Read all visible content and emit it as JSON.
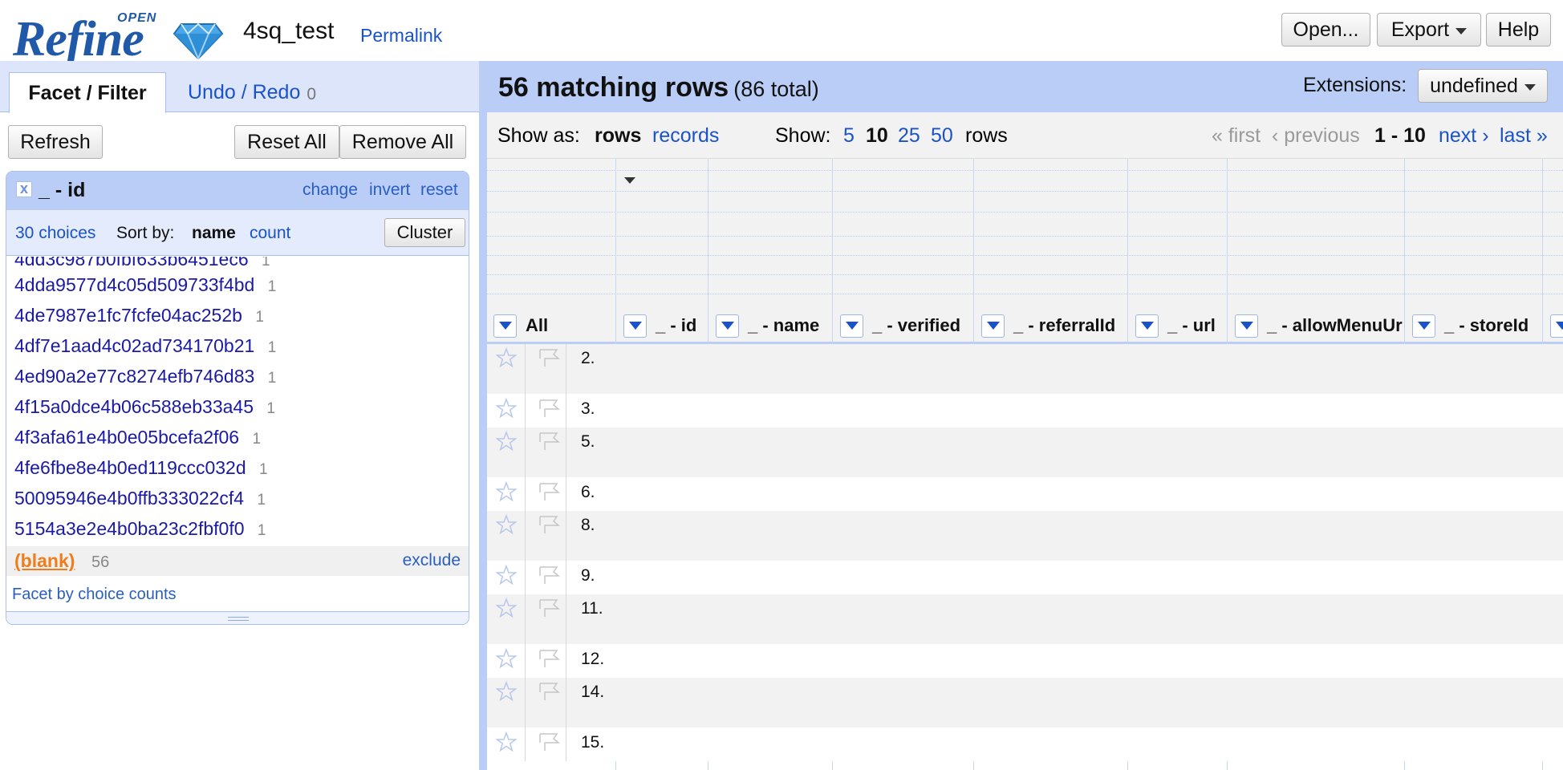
{
  "header": {
    "logo_text": "Refine",
    "logo_open": "OPEN",
    "project_name": "4sq_test",
    "permalink": "Permalink",
    "buttons": {
      "open": "Open...",
      "export": "Export",
      "help": "Help"
    }
  },
  "left_panel": {
    "tabs": {
      "facet_filter": "Facet / Filter",
      "undo_redo": "Undo / Redo",
      "undo_count": "0"
    },
    "buttons": {
      "refresh": "Refresh",
      "reset_all": "Reset All",
      "remove_all": "Remove All"
    },
    "facet": {
      "close": "x",
      "title": "_ - id",
      "links": {
        "change": "change",
        "invert": "invert",
        "reset": "reset"
      },
      "choices_count": "30 choices",
      "sort_by": "Sort by:",
      "sort_name": "name",
      "sort_count": "count",
      "cluster": "Cluster",
      "partial_choice": "4dd3c987b0fbf633b6451ec6",
      "choices": [
        {
          "value": "4dda9577d4c05d509733f4bd",
          "count": "1"
        },
        {
          "value": "4de7987e1fc7fcfe04ac252b",
          "count": "1"
        },
        {
          "value": "4df7e1aad4c02ad734170b21",
          "count": "1"
        },
        {
          "value": "4ed90a2e77c8274efb746d83",
          "count": "1"
        },
        {
          "value": "4f15a0dce4b06c588eb33a45",
          "count": "1"
        },
        {
          "value": "4f3afa61e4b0e05bcefa2f06",
          "count": "1"
        },
        {
          "value": "4fe6fbe8e4b0ed119ccc032d",
          "count": "1"
        },
        {
          "value": "50095946e4b0ffb333022cf4",
          "count": "1"
        },
        {
          "value": "5154a3e2e4b0ba23c2fbf0f0",
          "count": "1"
        }
      ],
      "blank": {
        "label": "(blank)",
        "count": "56",
        "exclude": "exclude"
      },
      "facet_by_counts": "Facet by choice counts"
    }
  },
  "right_panel": {
    "summary": {
      "matching": "56 matching rows",
      "total": "(86 total)"
    },
    "extensions": {
      "label": "Extensions:",
      "value": "undefined"
    },
    "view": {
      "show_as": "Show as:",
      "rows": "rows",
      "records": "records",
      "show": "Show:",
      "page_sizes": [
        "5",
        "10",
        "25",
        "50"
      ],
      "selected_page_size": "10",
      "rows_suffix": "rows",
      "first": "« first",
      "previous": "‹ previous",
      "range": "1 - 10",
      "next": "next ›",
      "last": "last »"
    },
    "columns": [
      "All",
      "_ - id",
      "_ - name",
      "_ - verified",
      "_ - referralId",
      "_ - url",
      "_ - allowMenuUr",
      "_ - storeId"
    ],
    "rows": [
      "2.",
      "3.",
      "5.",
      "6.",
      "8.",
      "9.",
      "11.",
      "12.",
      "14.",
      "15."
    ],
    "colors": {
      "accent_blue": "#1a53c9",
      "header_bg": "#b9cdf7",
      "blank_orange": "#f07c1c"
    }
  }
}
